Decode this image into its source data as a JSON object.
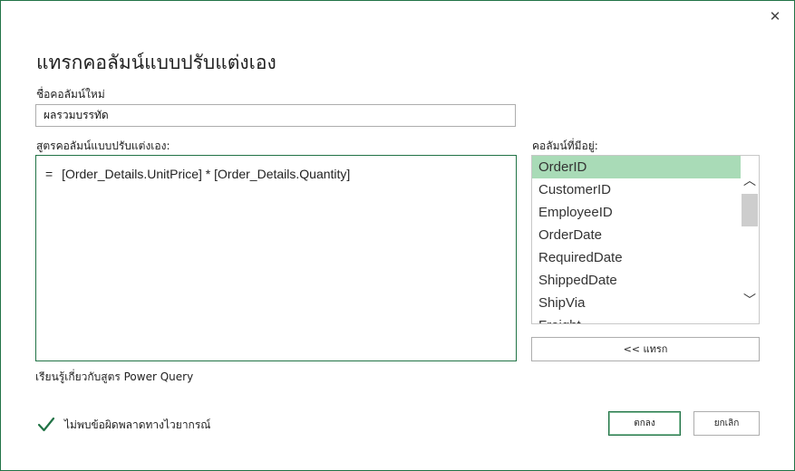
{
  "dialog": {
    "title": "แทรกคอลัมน์แบบปรับแต่งเอง",
    "close_symbol": "✕"
  },
  "new_column_name": {
    "label": "ชื่อคอลัมน์ใหม่",
    "value": "ผลรวมบรรทัด"
  },
  "formula": {
    "label": "สูตรคอลัมน์แบบปรับแต่งเอง:",
    "equals": "=",
    "expression": "[Order_Details.UnitPrice] * [Order_Details.Quantity]"
  },
  "available_columns": {
    "label": "คอลัมน์ที่มีอยู่:",
    "items": [
      "OrderID",
      "CustomerID",
      "EmployeeID",
      "OrderDate",
      "RequiredDate",
      "ShippedDate",
      "ShipVia",
      "Freight"
    ],
    "selected_index": 0,
    "scroll_up_symbol": "︿",
    "scroll_down_symbol": "﹀"
  },
  "insert_button": {
    "label": "<< แทรก"
  },
  "learn_link": {
    "label": "เรียนรู้เกี่ยวกับสูตร Power Query"
  },
  "status": {
    "text": "ไม่พบข้อผิดพลาดทางไวยากรณ์",
    "icon": "check-icon",
    "color": "#217346"
  },
  "buttons": {
    "ok": "ตกลง",
    "cancel": "ยกเลิก"
  },
  "colors": {
    "accent": "#217346",
    "selected_row": "#a9dbb7"
  }
}
